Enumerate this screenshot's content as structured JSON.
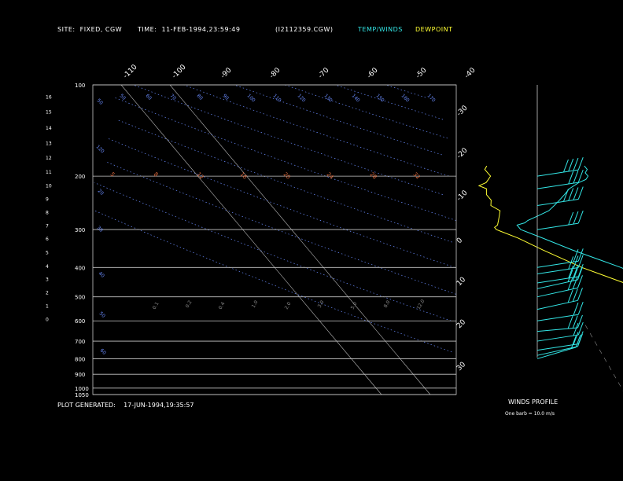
{
  "header": {
    "site_label": "SITE:",
    "site_value": "FIXED, CGW",
    "time_label": "TIME:",
    "time_value": "11-FEB-1994,23:59:49",
    "file_id": "(I2112359.CGW)",
    "legend_temp": "TEMP/WINDS",
    "legend_dew": "DEWPOINT"
  },
  "footer": {
    "generated_label": "PLOT GENERATED:",
    "generated_value": "17-JUN-1994,19:35:57"
  },
  "wind_panel": {
    "title": "WINDS PROFILE",
    "barb_note": "One barb = 10.0 m/s"
  },
  "colors": {
    "background": "#000000",
    "text": "#ffffff",
    "isobar": "#c8c8c8",
    "isotherm": "#b4b4b4",
    "dry_adiabat": "#6a8cff",
    "saturated_adiabat": "#e06a3c",
    "mixing_ratio": "#8a8a8a",
    "temp": "#33e6e6",
    "dewpoint": "#ffff33"
  },
  "chart_data": {
    "type": "line",
    "subtype": "skew-T log-P",
    "y_scale": "log",
    "ylim_hpa": [
      1050,
      100
    ],
    "xlim_top_c": [
      -110,
      -40
    ],
    "pressure_ticks_hpa": [
      "100",
      "200",
      "300",
      "400",
      "500",
      "600",
      "700",
      "800",
      "900",
      "1000",
      "1050"
    ],
    "pressure_values_hpa": [
      100,
      200,
      300,
      400,
      500,
      600,
      700,
      800,
      900,
      1000,
      1050
    ],
    "height_ticks_km": [
      "16",
      "15",
      "14",
      "13",
      "12",
      "11",
      "10",
      "9",
      "8",
      "7",
      "6",
      "5",
      "4",
      "3",
      "2",
      "1",
      "0"
    ],
    "height_pressures_hpa": [
      109,
      122,
      138,
      155,
      173,
      193,
      214,
      237,
      262,
      290,
      320,
      355,
      394,
      436,
      482,
      533,
      590
    ],
    "temp_top_labels": [
      "-110",
      "-100",
      "-90",
      "-80",
      "-70",
      "-60",
      "-50",
      "-40"
    ],
    "temp_right_labels": [
      "-30",
      "-20",
      "-10",
      "0",
      "10",
      "20",
      "30"
    ],
    "dry_adiabat_labels": [
      "50",
      "50",
      "60",
      "70",
      "80",
      "90",
      "100",
      "110",
      "120",
      "130",
      "140",
      "150",
      "160",
      "170",
      "120",
      "20",
      "30",
      "40",
      "50",
      "60"
    ],
    "sat_adiabat_labels": [
      "5",
      "8",
      "12",
      "16",
      "20",
      "24",
      "28",
      "32"
    ],
    "mixing_ratio_labels": [
      "0.1",
      "0.2",
      "0.4",
      "1.0",
      "2.0",
      "3.0",
      "5.0",
      "8.0",
      "12.0"
    ],
    "series": [
      {
        "name": "TEMP/WINDS",
        "color": "#33e6e6",
        "pressure_hpa": [
          800,
          795,
          790,
          780,
          760,
          740,
          720,
          700,
          680,
          650,
          600,
          570,
          550,
          500,
          450,
          400,
          350,
          320,
          300,
          290,
          285,
          280,
          270,
          260,
          250,
          240,
          230,
          220,
          210,
          205,
          200,
          195,
          190,
          185
        ],
        "temp_c": [
          -20,
          -21,
          -22,
          -23,
          -22,
          -23,
          -22,
          -22,
          -23,
          -23,
          -24,
          -25,
          -26,
          -29,
          -34,
          -39,
          -46,
          -50,
          -53,
          -53,
          -51,
          -50,
          -47,
          -44,
          -42,
          -40,
          -38,
          -36,
          -33,
          -31,
          -30,
          -30,
          -29,
          -29
        ]
      },
      {
        "name": "DEWPOINT",
        "color": "#ffff33",
        "pressure_hpa": [
          800,
          790,
          770,
          750,
          730,
          700,
          680,
          650,
          600,
          570,
          550,
          500,
          450,
          400,
          350,
          320,
          300,
          295,
          290,
          280,
          270,
          260,
          250,
          240,
          230,
          220,
          215,
          210,
          205,
          200,
          195,
          190,
          185
        ],
        "dewpoint_c": [
          -25,
          -25,
          -24,
          -26,
          -24,
          -25,
          -26,
          -25,
          -27,
          -28,
          -30,
          -35,
          -41,
          -47,
          -52,
          -55,
          -58,
          -58,
          -57,
          -56,
          -55,
          -54,
          -55,
          -54,
          -54,
          -53,
          -54,
          -52,
          -51,
          -50,
          -50,
          -50,
          -49
        ]
      }
    ],
    "winds": {
      "pressure_hpa": [
        800,
        780,
        750,
        700,
        650,
        600,
        550,
        500,
        470,
        450,
        420,
        400,
        300,
        250,
        220,
        200
      ],
      "speed_ms": [
        15,
        12,
        18,
        20,
        25,
        22,
        30,
        25,
        25,
        30,
        25,
        20,
        30,
        35,
        30,
        35
      ],
      "dir_deg": [
        250,
        260,
        270,
        270,
        280,
        270,
        260,
        260,
        260,
        270,
        270,
        270,
        270,
        270,
        270,
        270
      ]
    }
  }
}
